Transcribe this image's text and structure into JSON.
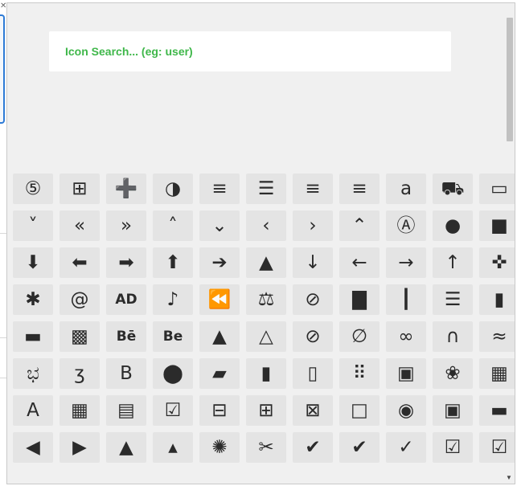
{
  "search": {
    "placeholder": "Icon Search... (eg: user)"
  },
  "icons": [
    {
      "name": "500px-icon",
      "glyph": "⑤"
    },
    {
      "name": "cart-plus-icon",
      "glyph": "⊞"
    },
    {
      "name": "user-plus-icon",
      "glyph": "➕"
    },
    {
      "name": "adjust-icon",
      "glyph": "◑"
    },
    {
      "name": "align-center-icon",
      "glyph": "≡"
    },
    {
      "name": "align-justify-icon",
      "glyph": "☰"
    },
    {
      "name": "align-left-icon",
      "glyph": "≡"
    },
    {
      "name": "align-right-icon",
      "glyph": "≡"
    },
    {
      "name": "amazon-icon",
      "glyph": "a"
    },
    {
      "name": "ambulance-icon",
      "glyph": "⛟"
    },
    {
      "name": "id-card-icon",
      "glyph": "▭"
    },
    {
      "name": "angle-double-down-icon",
      "glyph": "˅"
    },
    {
      "name": "angle-double-left-icon",
      "glyph": "«"
    },
    {
      "name": "angle-double-right-icon",
      "glyph": "»"
    },
    {
      "name": "angle-double-up-icon",
      "glyph": "˄"
    },
    {
      "name": "angle-down-icon",
      "glyph": "⌄"
    },
    {
      "name": "angle-left-icon",
      "glyph": "‹"
    },
    {
      "name": "angle-right-icon",
      "glyph": "›"
    },
    {
      "name": "angle-up-icon",
      "glyph": "⌃"
    },
    {
      "name": "app-store-icon",
      "glyph": "Ⓐ"
    },
    {
      "name": "apple-icon",
      "glyph": "●"
    },
    {
      "name": "archive-icon",
      "glyph": "■"
    },
    {
      "name": "arrow-circle-down-icon",
      "glyph": "⬇"
    },
    {
      "name": "arrow-circle-left-icon",
      "glyph": "⬅"
    },
    {
      "name": "arrow-circle-right-icon",
      "glyph": "➡"
    },
    {
      "name": "arrow-circle-up-icon",
      "glyph": "⬆"
    },
    {
      "name": "arrow-circle-right-solid-icon",
      "glyph": "➔"
    },
    {
      "name": "arrow-circle-up-solid-icon",
      "glyph": "▲"
    },
    {
      "name": "arrow-down-icon",
      "glyph": "↓"
    },
    {
      "name": "arrow-left-icon",
      "glyph": "←"
    },
    {
      "name": "arrow-right-icon",
      "glyph": "→"
    },
    {
      "name": "arrow-up-icon",
      "glyph": "↑"
    },
    {
      "name": "arrows-icon",
      "glyph": "✜"
    },
    {
      "name": "asterisk-icon",
      "glyph": "✱"
    },
    {
      "name": "at-icon",
      "glyph": "@"
    },
    {
      "name": "audio-description-icon",
      "glyph": "AD"
    },
    {
      "name": "file-audio-icon",
      "glyph": "♪"
    },
    {
      "name": "backward-icon",
      "glyph": "⏪"
    },
    {
      "name": "balance-scale-icon",
      "glyph": "⚖"
    },
    {
      "name": "ban-icon",
      "glyph": "⊘"
    },
    {
      "name": "bar-chart-icon",
      "glyph": "▇"
    },
    {
      "name": "barcode-icon",
      "glyph": "┃"
    },
    {
      "name": "bars-icon",
      "glyph": "☰"
    },
    {
      "name": "battery-icon",
      "glyph": "▮"
    },
    {
      "name": "bed-icon",
      "glyph": "▬"
    },
    {
      "name": "beer-icon",
      "glyph": "▩"
    },
    {
      "name": "behance-icon",
      "glyph": "Bē"
    },
    {
      "name": "behance-square-icon",
      "glyph": "Be"
    },
    {
      "name": "bell-icon",
      "glyph": "▲"
    },
    {
      "name": "bell-o-icon",
      "glyph": "△"
    },
    {
      "name": "bell-slash-icon",
      "glyph": "⊘"
    },
    {
      "name": "bell-slash-o-icon",
      "glyph": "∅"
    },
    {
      "name": "bicycle-icon",
      "glyph": "∞"
    },
    {
      "name": "binoculars-icon",
      "glyph": "∩"
    },
    {
      "name": "birthday-cake-icon",
      "glyph": "≈"
    },
    {
      "name": "bluetooth-icon",
      "glyph": "ಭ"
    },
    {
      "name": "bluetooth-b-icon",
      "glyph": "ʒ"
    },
    {
      "name": "bold-icon",
      "glyph": "B"
    },
    {
      "name": "bomb-icon",
      "glyph": "⬤"
    },
    {
      "name": "book-icon",
      "glyph": "▰"
    },
    {
      "name": "bookmark-icon",
      "glyph": "▮"
    },
    {
      "name": "bookmark-o-icon",
      "glyph": "▯"
    },
    {
      "name": "braille-icon",
      "glyph": "⠿"
    },
    {
      "name": "briefcase-icon",
      "glyph": "▣"
    },
    {
      "name": "bug-icon",
      "glyph": "❀"
    },
    {
      "name": "building-icon",
      "glyph": "▦"
    },
    {
      "name": "font-awesome-icon",
      "glyph": "A"
    },
    {
      "name": "calculator-icon",
      "glyph": "▦"
    },
    {
      "name": "calendar-icon",
      "glyph": "▤"
    },
    {
      "name": "calendar-check-icon",
      "glyph": "☑"
    },
    {
      "name": "calendar-minus-icon",
      "glyph": "⊟"
    },
    {
      "name": "calendar-plus-icon",
      "glyph": "⊞"
    },
    {
      "name": "calendar-times-icon",
      "glyph": "⊠"
    },
    {
      "name": "calendar-o-icon",
      "glyph": "□"
    },
    {
      "name": "camera-icon",
      "glyph": "◉"
    },
    {
      "name": "camera-retro-icon",
      "glyph": "▣"
    },
    {
      "name": "car-icon",
      "glyph": "▬"
    },
    {
      "name": "caret-square-left-icon",
      "glyph": "◀"
    },
    {
      "name": "caret-square-right-icon",
      "glyph": "▶"
    },
    {
      "name": "caret-square-up-icon",
      "glyph": "▲"
    },
    {
      "name": "caret-up-icon",
      "glyph": "▴"
    },
    {
      "name": "certificate-icon",
      "glyph": "✺"
    },
    {
      "name": "chain-broken-icon",
      "glyph": "✂"
    },
    {
      "name": "check-icon",
      "glyph": "✔"
    },
    {
      "name": "check-circle-icon",
      "glyph": "✔"
    },
    {
      "name": "check-circle-o-icon",
      "glyph": "✓"
    },
    {
      "name": "check-square-icon",
      "glyph": "☑"
    },
    {
      "name": "check-square-o-icon",
      "glyph": "☑"
    }
  ]
}
